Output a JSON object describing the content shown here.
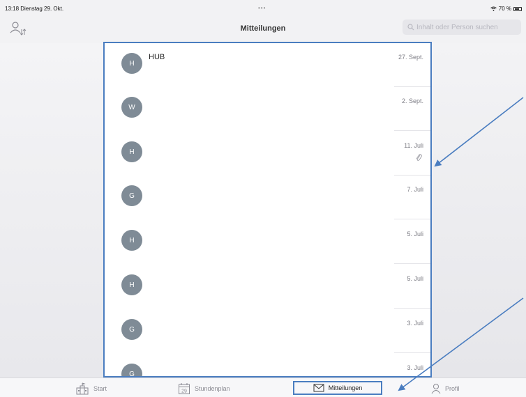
{
  "status_bar": {
    "time_date": "13:18  Dienstag 29. Okt.",
    "dots": "•••",
    "battery_text": "70 %"
  },
  "header": {
    "title": "Mitteilungen",
    "search_placeholder": "Inhalt oder Person suchen"
  },
  "messages": [
    {
      "initial": "H",
      "sender": "HUB",
      "date": "27. Sept."
    },
    {
      "initial": "W",
      "sender": "",
      "date": "2. Sept."
    },
    {
      "initial": "H",
      "sender": "",
      "date": "11. Juli",
      "icon": "paperclip-icon"
    },
    {
      "initial": "G",
      "sender": "",
      "date": "7. Juli"
    },
    {
      "initial": "H",
      "sender": "",
      "date": "5. Juli"
    },
    {
      "initial": "H",
      "sender": "",
      "date": "5. Juli"
    },
    {
      "initial": "G",
      "sender": "",
      "date": "3. Juli"
    },
    {
      "initial": "G",
      "sender": "",
      "date": "3. Juli"
    }
  ],
  "tabs": [
    {
      "label": "Start",
      "icon": "school-icon"
    },
    {
      "label": "Stundenplan",
      "icon": "calendar-icon",
      "icon_text": "29"
    },
    {
      "label": "Mitteilungen",
      "icon": "envelope-icon"
    },
    {
      "label": "Profil",
      "icon": "person-icon"
    }
  ],
  "colors": {
    "annotation_blue": "#4a7dc0",
    "avatar_gray": "#7f8b96"
  }
}
